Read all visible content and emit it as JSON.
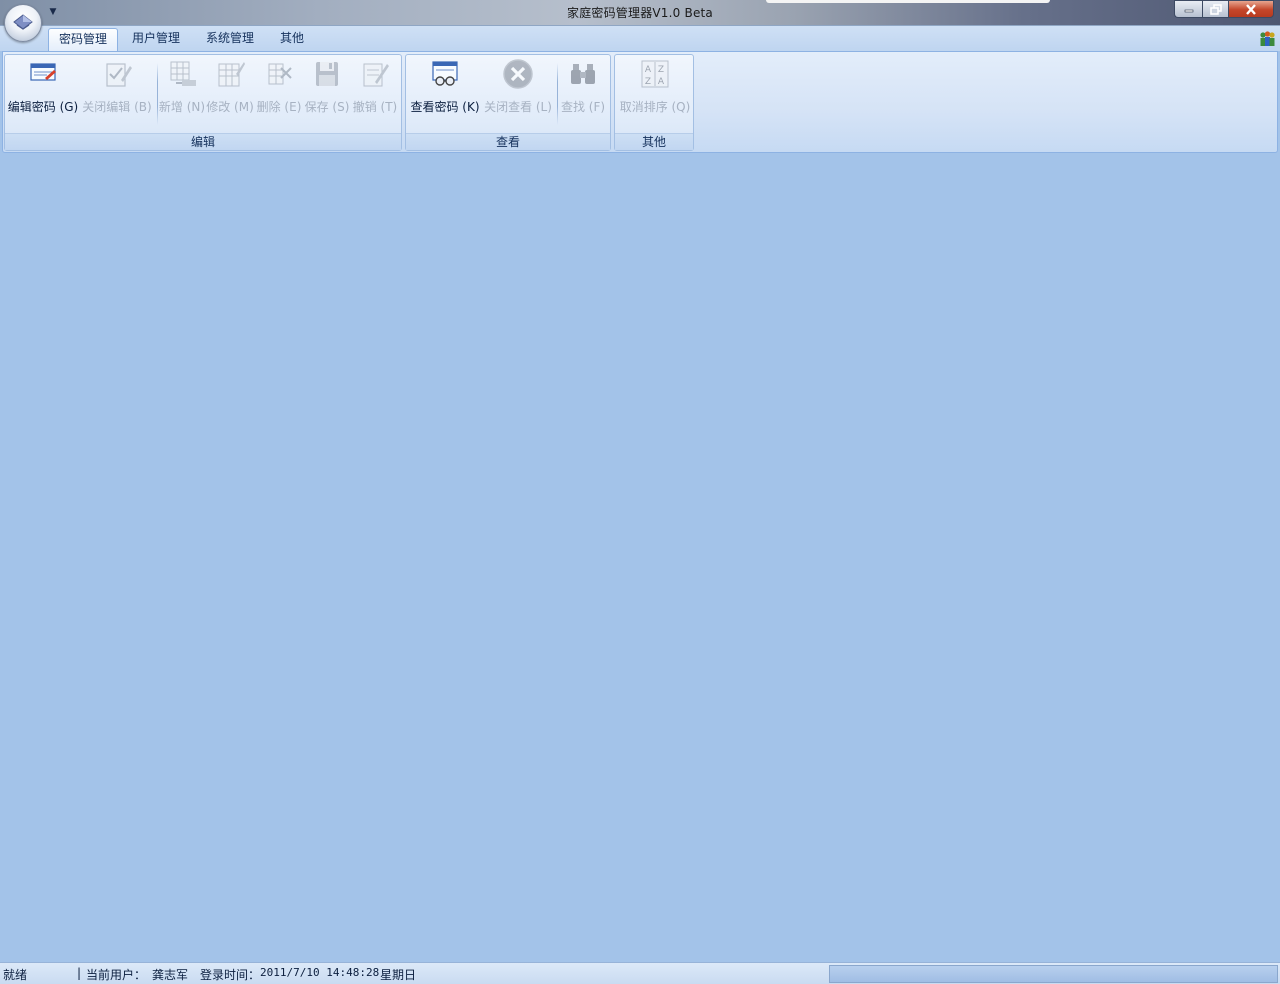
{
  "window": {
    "title": "家庭密码管理器V1.0 Beta",
    "qat_icon": "chevron-down-icon",
    "app_icon": "diamond-orb-icon",
    "buttons": {
      "minimize_icon": "minimize-icon",
      "maximize_icon": "restore-icon",
      "close_icon": "close-icon"
    }
  },
  "tabs": [
    {
      "label": "密码管理",
      "active": true
    },
    {
      "label": "用户管理",
      "active": false
    },
    {
      "label": "系统管理",
      "active": false
    },
    {
      "label": "其他",
      "active": false
    }
  ],
  "help_icon": "users-help-icon",
  "ribbon": {
    "groups": [
      {
        "label": "编辑",
        "buttons": [
          {
            "label": "编辑密码 (G)",
            "icon": "edit-password-icon",
            "enabled": true
          },
          {
            "label": "关闭编辑 (B)",
            "icon": "checklist-pen-icon",
            "enabled": false
          },
          {
            "label": "新增 (N)",
            "icon": "table-add-icon",
            "enabled": false
          },
          {
            "label": "修改 (M)",
            "icon": "table-edit-icon",
            "enabled": false
          },
          {
            "label": "删除 (E)",
            "icon": "table-delete-icon",
            "enabled": false
          },
          {
            "label": "保存 (S)",
            "icon": "floppy-disk-icon",
            "enabled": false
          },
          {
            "label": "撤销 (T)",
            "icon": "undo-pen-icon",
            "enabled": false
          }
        ]
      },
      {
        "label": "查看",
        "buttons": [
          {
            "label": "查看密码 (K)",
            "icon": "view-glasses-icon",
            "enabled": true
          },
          {
            "label": "关闭查看 (L)",
            "icon": "close-circle-icon",
            "enabled": false
          },
          {
            "label": "查找 (F)",
            "icon": "binoculars-icon",
            "enabled": false
          }
        ]
      },
      {
        "label": "其他",
        "buttons": [
          {
            "label": "取消排序 (Q)",
            "icon": "sort-az-icon",
            "enabled": false
          }
        ]
      }
    ]
  },
  "statusbar": {
    "ready": "就绪",
    "separator": "|",
    "user_label": "当前用户：",
    "user": "龚志军",
    "login_label": "登录时间：",
    "login_time": "2011/7/10 14:48:28",
    "weekday": "星期日"
  },
  "colors": {
    "workspace": "#a3c3e9",
    "ribbon_border": "#8db2e3",
    "text_primary": "#0c1f3f",
    "text_disabled": "#a7b2c2",
    "close_button": "#c4462a"
  }
}
